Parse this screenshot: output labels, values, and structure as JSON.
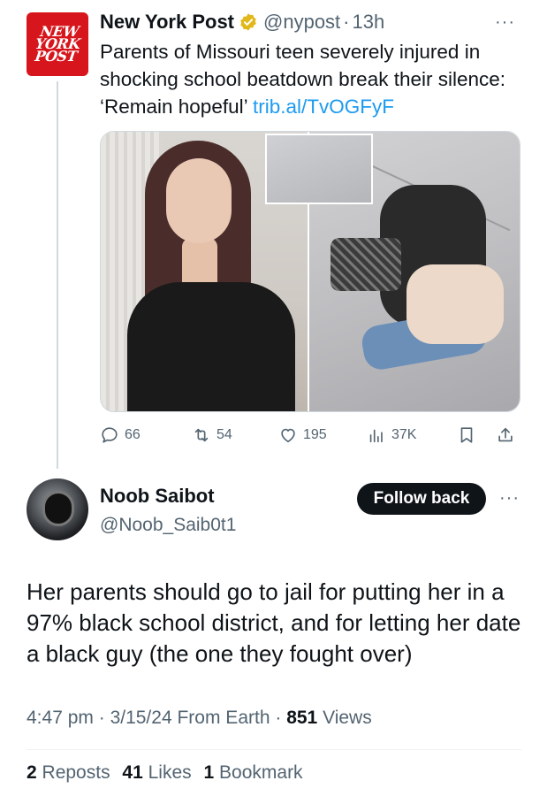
{
  "parent_tweet": {
    "avatar_text": [
      "NEW",
      "YORK",
      "POST"
    ],
    "name": "New York Post",
    "handle": "@nypost",
    "time": "13h",
    "text": "Parents of Missouri teen severely injured in shocking school beatdown break their silence: ‘Remain hopeful’ ",
    "link": "trib.al/TvOGFyF",
    "actions": {
      "replies": "66",
      "reposts": "54",
      "likes": "195",
      "views": "37K"
    },
    "more_icon": "···"
  },
  "tweet": {
    "name": "Noob Saibot",
    "handle": "@Noob_Saib0t1",
    "follow_label": "Follow back",
    "more_icon": "···",
    "text": "Her parents should go to jail for putting her in a 97% black school district, and for letting her date a black guy (the one they fought over)",
    "time": "4:47 pm",
    "date": "3/15/24",
    "source": "From Earth",
    "views_count": "851",
    "views_label": "Views",
    "reposts_count": "2",
    "reposts_label": "Reposts",
    "likes_count": "41",
    "likes_label": "Likes",
    "bookmarks_count": "1",
    "bookmarks_label": "Bookmark"
  },
  "colors": {
    "link": "#1d9bf0",
    "secondary_text": "#536471",
    "verified_gold": "#e2b719",
    "brand_red": "#d6151c"
  }
}
